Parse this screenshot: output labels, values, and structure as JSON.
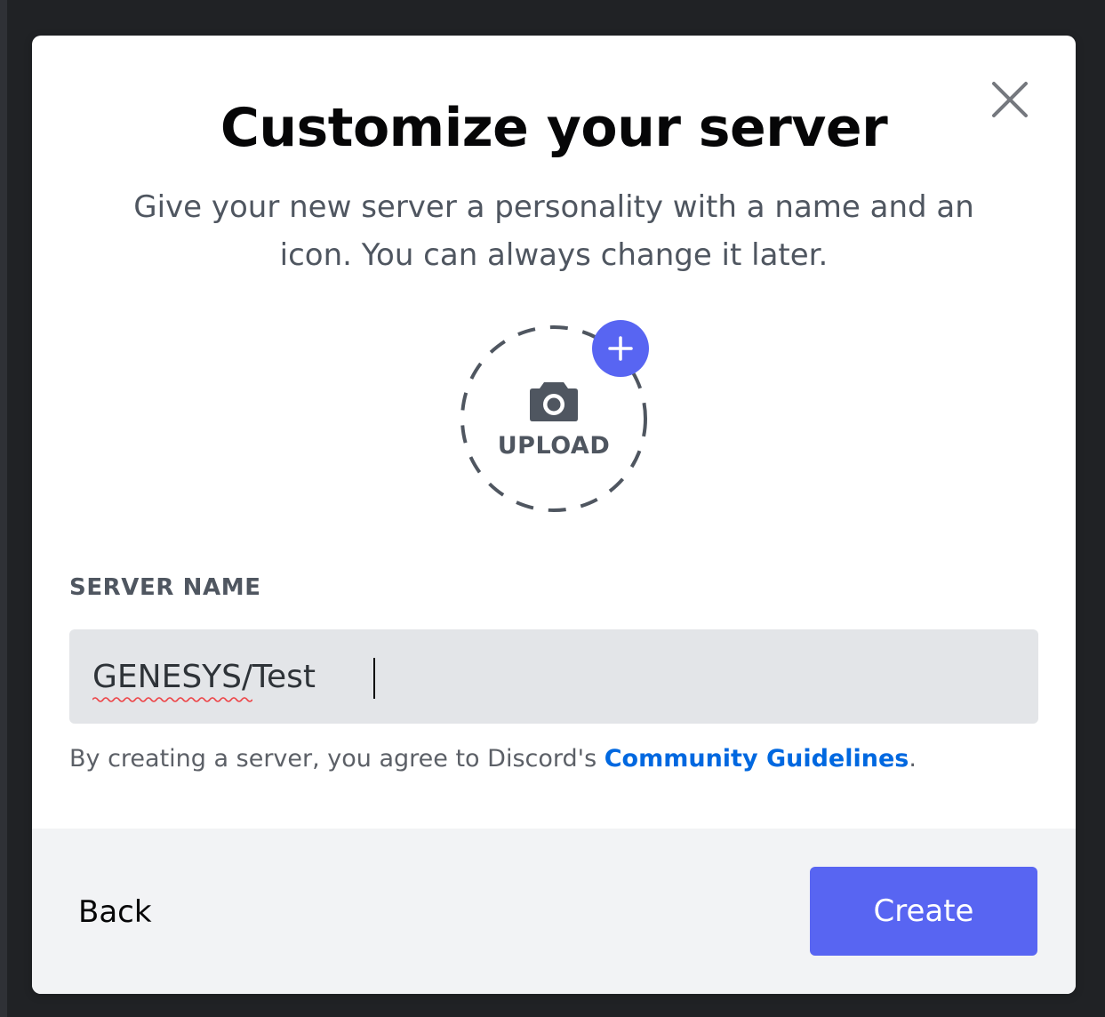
{
  "modal": {
    "title": "Customize your server",
    "subtitle": "Give your new server a personality with a name and an icon. You can always change it later.",
    "close_icon": "close-icon"
  },
  "uploader": {
    "label": "UPLOAD",
    "camera_icon": "camera-icon",
    "plus_icon": "plus-icon"
  },
  "server_name": {
    "label": "SERVER NAME",
    "value": "GENESYS/Test"
  },
  "terms": {
    "prefix": "By creating a server, you agree to Discord's ",
    "link": "Community Guidelines",
    "suffix": "."
  },
  "footer": {
    "back_label": "Back",
    "create_label": "Create"
  },
  "colors": {
    "accent": "#5865f2",
    "link": "#0068e0",
    "input_bg": "#e3e5e8",
    "footer_bg": "#f2f3f5"
  }
}
